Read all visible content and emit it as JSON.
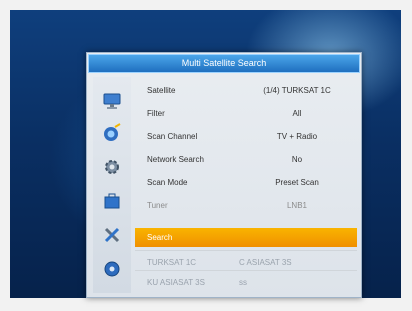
{
  "dialog": {
    "title": "Multi Satellite Search"
  },
  "icons": [
    "monitor-icon",
    "satellite-dish-icon",
    "gear-icon",
    "toolbox-icon",
    "tools-icon",
    "media-disc-icon"
  ],
  "settings": [
    {
      "label": "Satellite",
      "value": "(1/4) TURKSAT 1C"
    },
    {
      "label": "Filter",
      "value": "All"
    },
    {
      "label": "Scan Channel",
      "value": "TV + Radio"
    },
    {
      "label": "Network Search",
      "value": "No"
    },
    {
      "label": "Scan Mode",
      "value": "Preset Scan"
    },
    {
      "label": "Tuner",
      "value": "LNB1"
    }
  ],
  "search": {
    "label": "Search"
  },
  "results": [
    {
      "left": "TURKSAT 1C",
      "right": "C ASIASAT 3S"
    },
    {
      "left": "KU ASIASAT 3S",
      "right": "ss"
    }
  ],
  "colors": {
    "highlight": "#f5a300",
    "title_bar": "#2d86d3",
    "background": "#0a2f63"
  }
}
